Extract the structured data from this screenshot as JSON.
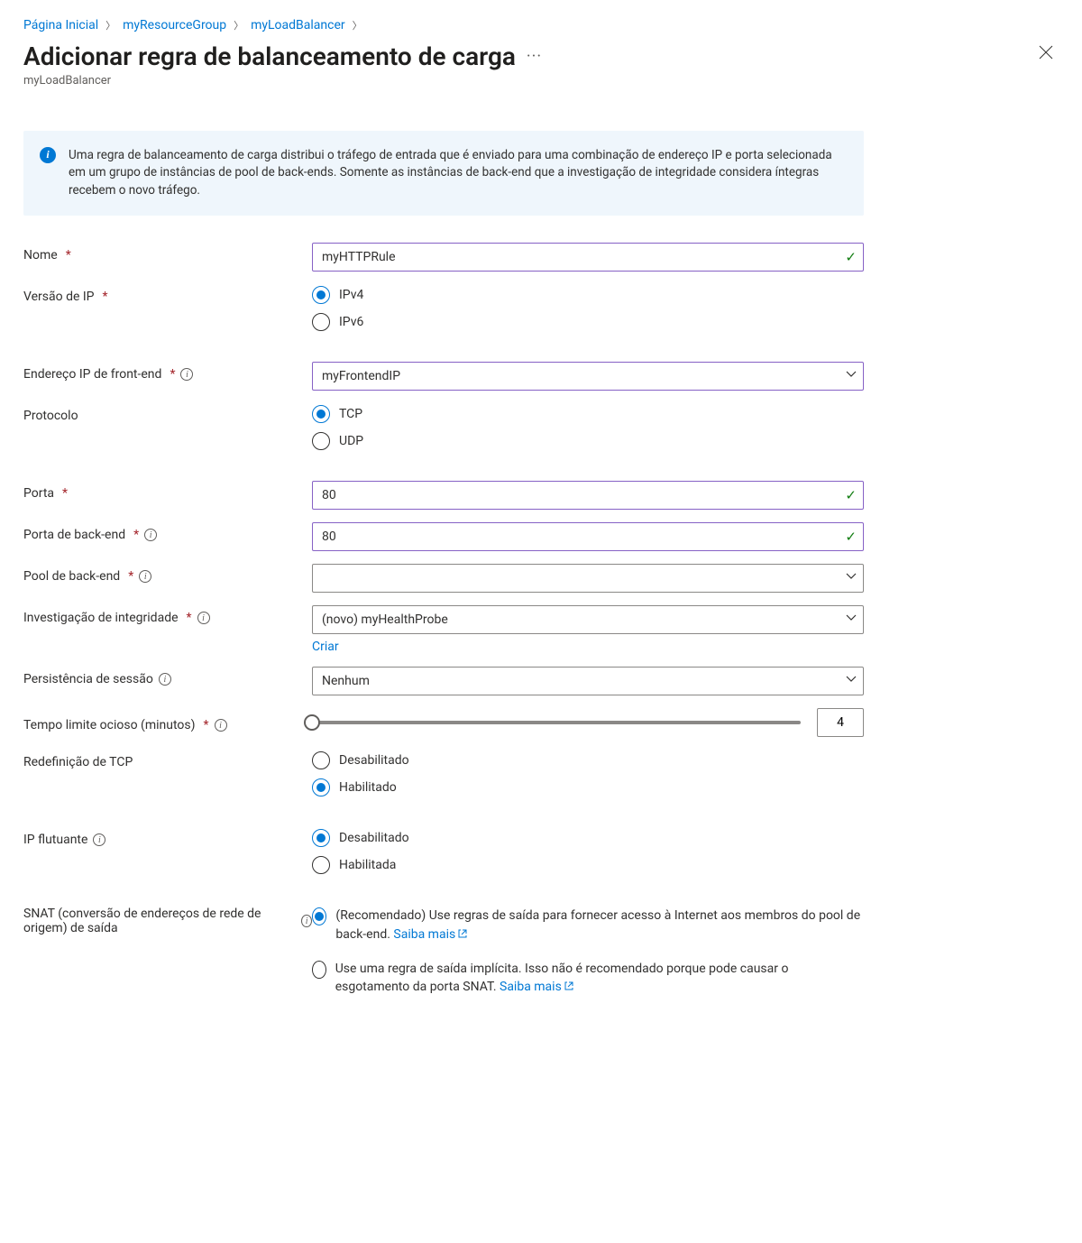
{
  "breadcrumb": {
    "home": "Página Inicial",
    "group": "myResourceGroup",
    "lb": "myLoadBalancer"
  },
  "header": {
    "title": "Adicionar regra de balanceamento de carga",
    "subtitle": "myLoadBalancer"
  },
  "info": {
    "text": "Uma regra de balanceamento de carga distribui o tráfego de entrada que é enviado para uma combinação de endereço IP e porta selecionada em um grupo de instâncias de pool de back-ends. Somente as instâncias de back-end que a investigação de integridade considera íntegras recebem o novo tráfego."
  },
  "labels": {
    "name": "Nome",
    "ipversion": "Versão de IP",
    "frontendip": "Endereço IP de front-end",
    "protocol": "Protocolo",
    "port": "Porta",
    "backendport": "Porta de back-end",
    "backendpool": "Pool de back-end",
    "healthprobe": "Investigação de integridade",
    "sessionpersist": "Persistência de sessão",
    "idletimeout": "Tempo limite ocioso (minutos)",
    "tcpreset": "Redefinição de TCP",
    "floatingip": "IP flutuante",
    "snat": "SNAT (conversão de endereços de rede de origem) de saída"
  },
  "values": {
    "name": "myHTTPRule",
    "frontendip": "myFrontendIP",
    "port": "80",
    "backendport": "80",
    "backendpool": "",
    "healthprobe": "(novo) myHealthProbe",
    "sessionpersist": "Nenhum",
    "idletimeout": "4"
  },
  "options": {
    "ipv4": "IPv4",
    "ipv6": "IPv6",
    "tcp": "TCP",
    "udp": "UDP",
    "disabled_m": "Desabilitado",
    "enabled_m": "Habilitado",
    "disabled_f": "Desabilitado",
    "enabled_f": "Habilitada",
    "snat_recommended": "(Recomendado) Use regras de saída para fornecer acesso à Internet aos membros do pool de back-end. ",
    "snat_implicit": "Use uma regra de saída implícita. Isso não é recomendado porque pode causar o esgotamento da porta SNAT. ",
    "learn_more": "Saiba mais"
  },
  "actions": {
    "create": "Criar"
  }
}
